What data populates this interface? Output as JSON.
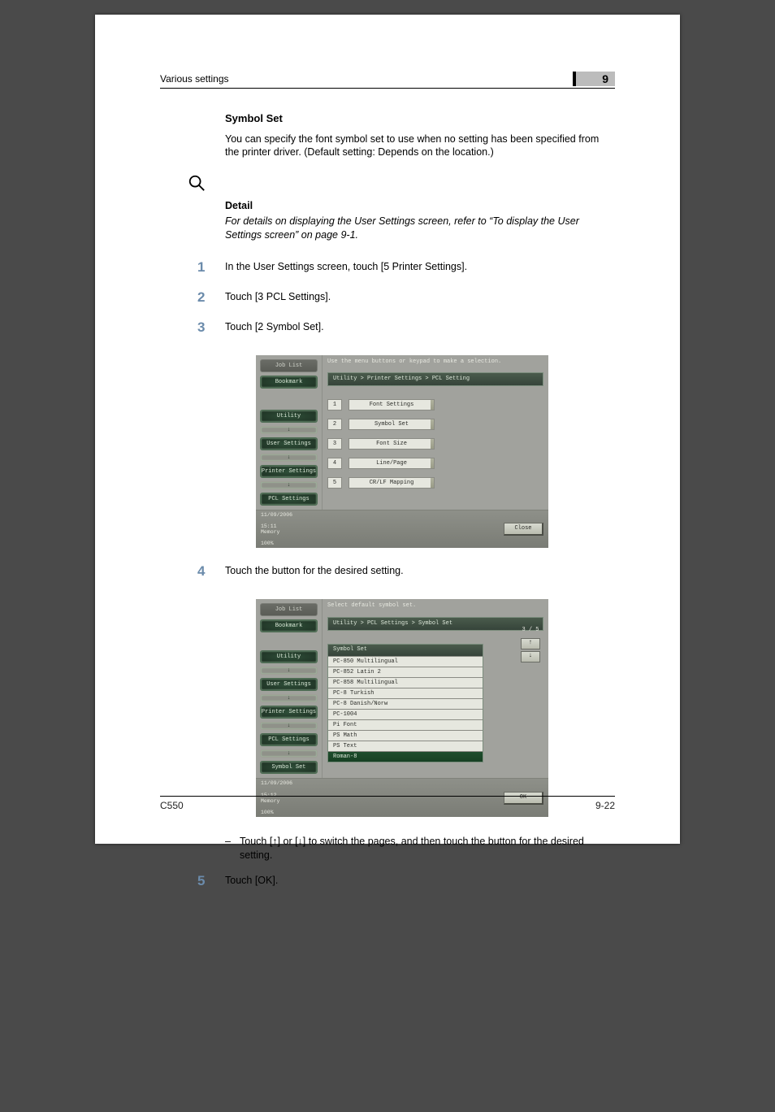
{
  "header": {
    "running_title": "Various settings",
    "chapter_number": "9"
  },
  "section": {
    "heading": "Symbol Set",
    "intro": "You can specify the font symbol set to use when no setting has been specified from the printer driver. (Default setting: Depends on the location.)"
  },
  "detail": {
    "label": "Detail",
    "text": "For details on displaying the User Settings screen, refer to “To display the User Settings screen” on page 9-1."
  },
  "steps": {
    "s1": {
      "num": "1",
      "text": "In the User Settings screen, touch [5 Printer Settings]."
    },
    "s2": {
      "num": "2",
      "text": "Touch [3 PCL Settings]."
    },
    "s3": {
      "num": "3",
      "text": "Touch [2 Symbol Set]."
    },
    "s4": {
      "num": "4",
      "text": "Touch the button for the desired setting."
    },
    "s4_sub": "Touch [↑] or [↓] to switch the pages, and then touch the button for the desired setting.",
    "s5": {
      "num": "5",
      "text": "Touch [OK]."
    }
  },
  "screenshot1": {
    "instruct": "Use the menu buttons or keypad to make a selection.",
    "breadcrumb": "Utility > Printer Settings > PCL Setting",
    "side": {
      "job_list": "Job List",
      "bookmark": "Bookmark",
      "utility": "Utility",
      "user_settings": "User Settings",
      "printer_settings": "Printer Settings",
      "pcl_settings": "PCL Settings"
    },
    "menu": {
      "r1_num": "1",
      "r1_label": "Font Settings",
      "r2_num": "2",
      "r2_label": "Symbol Set",
      "r3_num": "3",
      "r3_label": "Font Size",
      "r4_num": "4",
      "r4_label": "Line/Page",
      "r5_num": "5",
      "r5_label": "CR/LF Mapping"
    },
    "footer": {
      "date": "11/09/2006",
      "time": "15:11",
      "mem_label": "Memory",
      "mem_val": "100%",
      "close": "Close"
    }
  },
  "screenshot2": {
    "instruct": "Select default symbol set.",
    "breadcrumb": "Utility > PCL Settings > Symbol Set",
    "list_header": "Symbol Set",
    "paging": "3 /  5",
    "side": {
      "job_list": "Job List",
      "bookmark": "Bookmark",
      "utility": "Utility",
      "user_settings": "User Settings",
      "printer_settings": "Printer Settings",
      "pcl_settings": "PCL Settings",
      "symbol_set": "Symbol Set"
    },
    "items": {
      "i0": "PC-850 Multilingual",
      "i1": "PC-852 Latin 2",
      "i2": "PC-858 Multilingual",
      "i3": "PC-8 Turkish",
      "i4": "PC-8 Danish/Norw",
      "i5": "PC-1004",
      "i6": "Pi Font",
      "i7": "PS Math",
      "i8": "PS Text",
      "i9": "Roman-8"
    },
    "footer": {
      "date": "11/09/2006",
      "time": "15:12",
      "mem_label": "Memory",
      "mem_val": "100%",
      "ok": "OK"
    }
  },
  "page_footer": {
    "model": "C550",
    "page": "9-22"
  }
}
